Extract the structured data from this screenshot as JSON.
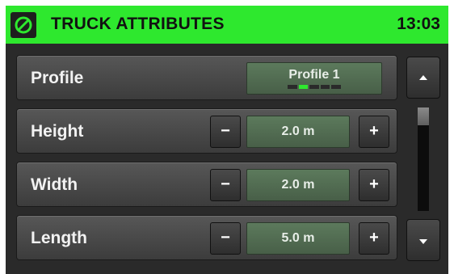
{
  "header": {
    "title": "TRUCK ATTRIBUTES",
    "time": "13:03",
    "icon": "compass-icon"
  },
  "rows": [
    {
      "label": "Profile",
      "value": "Profile 1",
      "page_count": 5,
      "active_page": 2
    },
    {
      "label": "Height",
      "value": "2.0 m"
    },
    {
      "label": "Width",
      "value": "2.0 m"
    },
    {
      "label": "Length",
      "value": "5.0 m"
    }
  ],
  "controls": {
    "minus": "−",
    "plus": "+",
    "scroll_up": "up-arrow-icon",
    "scroll_down": "down-arrow-icon"
  },
  "colors": {
    "accent": "#2ee82e",
    "panel": "#2a2a2a",
    "value_bg": "#526b52"
  }
}
